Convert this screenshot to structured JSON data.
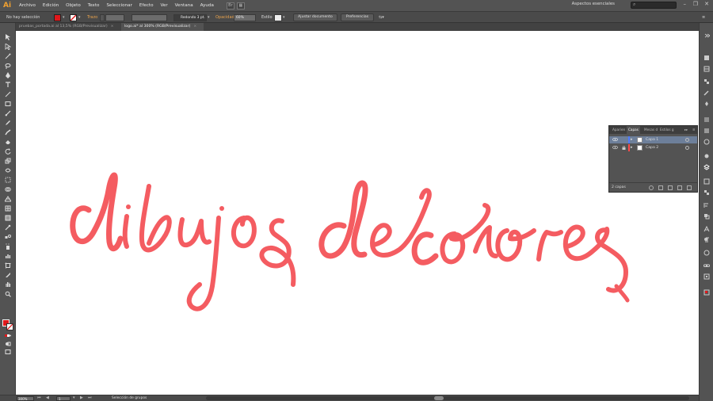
{
  "app": {
    "logo": "Ai",
    "bridge": "Br"
  },
  "menu": [
    "Archivo",
    "Edición",
    "Objeto",
    "Texto",
    "Seleccionar",
    "Efecto",
    "Ver",
    "Ventana",
    "Ayuda"
  ],
  "workspace": "Aspectos esenciales",
  "search": {
    "placeholder": ""
  },
  "window_controls": {
    "minimize": "–",
    "restore": "❐",
    "close": "✕"
  },
  "control_bar": {
    "selection_label": "No hay selección",
    "stroke_label": "Trazo",
    "brush_value": "Redondo 3 pt.",
    "opacity_label": "Opacidad",
    "opacity_value": "60%",
    "style_label": "Estilo",
    "fit_document_button": "Ajustar documento",
    "preferences_button": "Preferencias",
    "fill_color": "#e0181b"
  },
  "tabs": [
    {
      "label": "pruebas_portada.ai al 13,5% (RGB/Previsualizar)",
      "close": "×"
    },
    {
      "label": "logo.ai* al 300% (RGB/Previsualizar)",
      "close": "×"
    }
  ],
  "artwork": {
    "text": "dibujos de colores",
    "color": "#f45c61"
  },
  "layers_panel": {
    "tabs": [
      "Apariencia",
      "Capas",
      "Mesas de trabajo",
      "Estilos gráficos"
    ],
    "tab_labels_shown": [
      "Aparien",
      "Capas",
      "Mesas d",
      "Estilos g"
    ],
    "active_tab": "Capas",
    "layers": [
      {
        "name": "Capa 1",
        "selected": true,
        "locked": false,
        "color": "#4f7bff"
      },
      {
        "name": "Capa 2",
        "selected": false,
        "locked": true,
        "color": "#ff4a4a"
      }
    ],
    "count_label": "2 capas"
  },
  "status_bar": {
    "zoom": "300%",
    "page": "1",
    "mode": "Selección de grupos"
  }
}
